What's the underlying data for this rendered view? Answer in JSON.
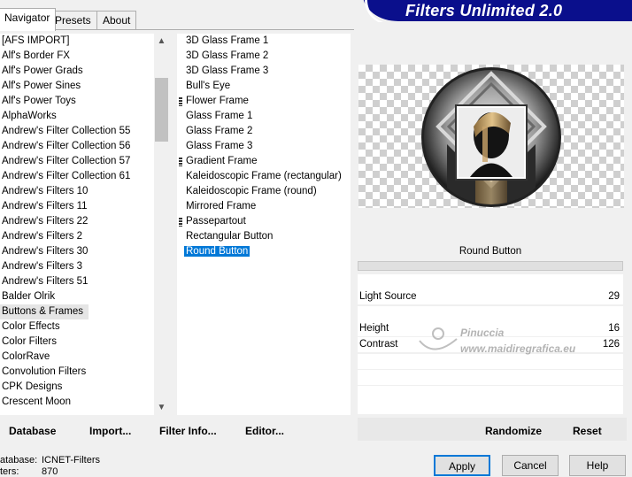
{
  "tabs": [
    {
      "label": "Navigator",
      "active": true
    },
    {
      "label": "Presets",
      "active": false
    },
    {
      "label": "About",
      "active": false
    }
  ],
  "banner": {
    "title": "Filters Unlimited 2.0"
  },
  "categories": [
    "[AFS IMPORT]",
    "Alf's Border FX",
    "Alf's Power Grads",
    "Alf's Power Sines",
    "Alf's Power Toys",
    "AlphaWorks",
    "Andrew's Filter Collection 55",
    "Andrew's Filter Collection 56",
    "Andrew's Filter Collection 57",
    "Andrew's Filter Collection 61",
    "Andrew's Filters 10",
    "Andrew's Filters 11",
    "Andrew's Filters 22",
    "Andrew's Filters 2",
    "Andrew's Filters 30",
    "Andrew's Filters 3",
    "Andrew's Filters 51",
    "Balder Olrik",
    "Buttons & Frames",
    "Color Effects",
    "Color Filters",
    "ColorRave",
    "Convolution Filters",
    "CPK Designs",
    "Crescent Moon"
  ],
  "selected_category": "Buttons & Frames",
  "filters": [
    {
      "label": "3D Glass Frame 1",
      "mark": false
    },
    {
      "label": "3D Glass Frame 2",
      "mark": false
    },
    {
      "label": "3D Glass Frame 3",
      "mark": false
    },
    {
      "label": "Bull's Eye",
      "mark": false
    },
    {
      "label": "Flower Frame",
      "mark": true
    },
    {
      "label": "Glass Frame 1",
      "mark": false
    },
    {
      "label": "Glass Frame 2",
      "mark": false
    },
    {
      "label": "Glass Frame 3",
      "mark": false
    },
    {
      "label": "Gradient Frame",
      "mark": true
    },
    {
      "label": "Kaleidoscopic Frame (rectangular)",
      "mark": false
    },
    {
      "label": "Kaleidoscopic Frame (round)",
      "mark": false
    },
    {
      "label": "Mirrored Frame",
      "mark": false
    },
    {
      "label": "Passepartout",
      "mark": true
    },
    {
      "label": "Rectangular Button",
      "mark": false
    },
    {
      "label": "Round Button",
      "mark": false
    }
  ],
  "selected_filter": "Round Button",
  "params": {
    "title": "Round Button",
    "light_source": {
      "label": "Light Source",
      "value": "29"
    },
    "height": {
      "label": "Height",
      "value": "16"
    },
    "contrast": {
      "label": "Contrast",
      "value": "126"
    }
  },
  "toolbar": {
    "database": "Database",
    "import": "Import...",
    "filter_info": "Filter Info...",
    "editor": "Editor...",
    "randomize": "Randomize",
    "reset": "Reset"
  },
  "status": {
    "database_label": "atabase:",
    "database_value": "ICNET-Filters",
    "filters_label": "ters:",
    "filters_value": "870"
  },
  "buttons": {
    "apply": "Apply",
    "cancel": "Cancel",
    "help": "Help"
  },
  "watermark": {
    "line1": "Pinuccia",
    "line2": "www.maidiregrafica.eu"
  },
  "colors": {
    "banner": "#0a0f8c",
    "selection": "#0078d7"
  }
}
